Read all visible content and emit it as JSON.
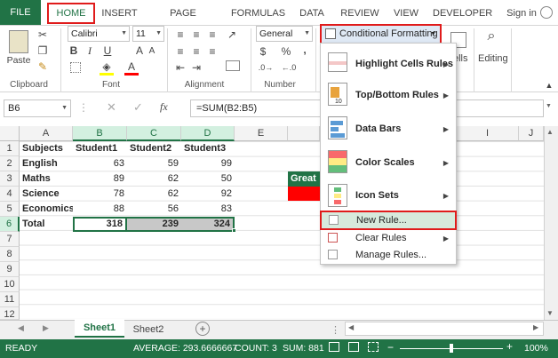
{
  "tabs": {
    "file": "FILE",
    "home": "HOME",
    "insert": "INSERT",
    "page_layout": "PAGE LAYOUT",
    "formulas": "FORMULAS",
    "data": "DATA",
    "review": "REVIEW",
    "view": "VIEW",
    "developer": "DEVELOPER",
    "sign_in": "Sign in"
  },
  "ribbon": {
    "paste": "Paste",
    "clipboard": "Clipboard",
    "font_name": "Calibri",
    "font_size": "11",
    "font": "Font",
    "alignment": "Alignment",
    "number_format": "General",
    "number": "Number",
    "currency": "$",
    "percent": "%",
    "comma": ",",
    "conditional_formatting": "Conditional Formatting",
    "cells_partial": "ells",
    "editing": "Editing"
  },
  "formula_bar": {
    "name_box": "B6",
    "fx": "fx",
    "formula": "=SUM(B2:B5)"
  },
  "columns": [
    "A",
    "B",
    "C",
    "D",
    "E",
    "I",
    "J"
  ],
  "rows": [
    "1",
    "2",
    "3",
    "4",
    "5",
    "6",
    "7",
    "8",
    "9",
    "10",
    "11",
    "12"
  ],
  "table": {
    "headers": [
      "Subjects",
      "Student1",
      "Student2",
      "Student3"
    ],
    "rows": [
      [
        "English",
        "63",
        "59",
        "99"
      ],
      [
        "Maths",
        "89",
        "62",
        "50"
      ],
      [
        "Science",
        "78",
        "62",
        "92"
      ],
      [
        "Economics",
        "88",
        "56",
        "83"
      ],
      [
        "Total",
        "318",
        "239",
        "324"
      ]
    ]
  },
  "side_note": "Great",
  "menu": {
    "highlight_cells_rules": "Highlight Cells Rules",
    "top_bottom_rules": "Top/Bottom Rules",
    "top_bottom_badge": "10",
    "data_bars": "Data Bars",
    "color_scales": "Color Scales",
    "icon_sets": "Icon Sets",
    "new_rule": "New Rule...",
    "clear_rules": "Clear Rules",
    "manage_rules": "Manage Rules..."
  },
  "sheets": {
    "sheet1": "Sheet1",
    "sheet2": "Sheet2",
    "add": "+"
  },
  "status": {
    "ready": "READY",
    "average": "AVERAGE: 293.6666667",
    "count": "COUNT: 3",
    "sum": "SUM: 881",
    "zoom": "100%"
  },
  "colors": {
    "excel_green": "#217346",
    "highlight_red": "#e01b1b",
    "selected_cell_fill": "#c8c8c8",
    "great_fill": "#217346",
    "red_fill": "#ff0000"
  }
}
